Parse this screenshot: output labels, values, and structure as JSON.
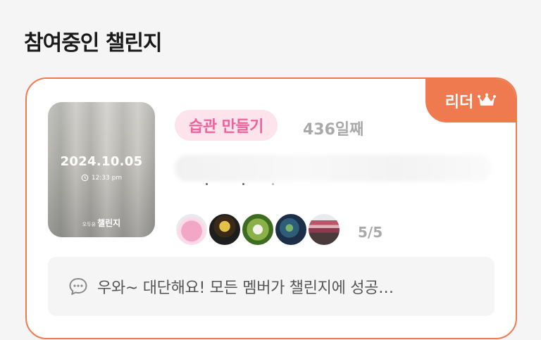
{
  "section": {
    "title": "참여중인 챌린지"
  },
  "challenge": {
    "leader_badge": "리더",
    "leader_icon": "crown-icon",
    "thumbnail": {
      "date": "2024.10.05",
      "time": "12:33 pm",
      "brand_small": "오두유",
      "brand": "챌린지"
    },
    "category_tag": "습관 만들기",
    "day_count": "436일째",
    "members": {
      "avatars": [
        "avatar-1",
        "avatar-2",
        "avatar-3",
        "avatar-4",
        "avatar-5"
      ],
      "count": "5/5"
    },
    "latest_comment": "우와~ 대단해요! 모든 멤버가 챌린지에 성공…"
  },
  "colors": {
    "accent": "#f07a4f",
    "tag_bg": "#fde3ec",
    "tag_text": "#f2629a",
    "muted_text": "#a9a9a9"
  }
}
